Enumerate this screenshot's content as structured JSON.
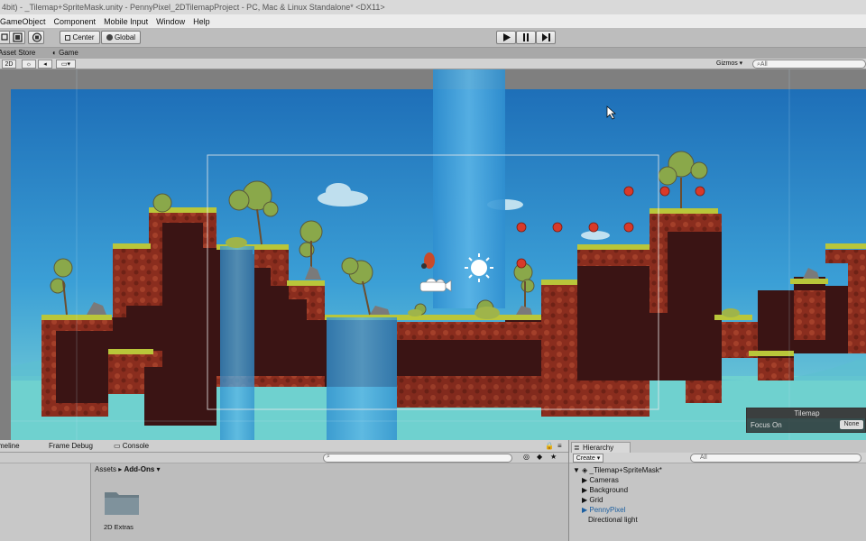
{
  "window": {
    "title": "4bit) - _Tilemap+SpriteMask.unity - PennyPixel_2DTilemapProject - PC, Mac & Linux Standalone* <DX11>"
  },
  "menu": {
    "items": [
      "GameObject",
      "Component",
      "Mobile Input",
      "Window",
      "Help"
    ]
  },
  "toolbar": {
    "pivot_label": "Center",
    "space_label": "Global",
    "play_icon": "play-icon",
    "pause_icon": "pause-icon",
    "step_icon": "step-icon"
  },
  "tabs": {
    "asset_store": "Asset Store",
    "game": "Game"
  },
  "scene_toolbar": {
    "mode_2d": "2D",
    "gizmos": "Gizmos",
    "search_prefix": "All"
  },
  "tilemap_panel": {
    "title": "Tilemap",
    "focus_label": "Focus On",
    "focus_value": "None"
  },
  "bottom_tabs": {
    "timeline": "meline",
    "frame_debug": "Frame Debug",
    "console": "Console"
  },
  "project": {
    "path_root": "Assets",
    "path_sep": "▸",
    "path_current": "Add-Ons",
    "folder_label": "2D Extras"
  },
  "hierarchy": {
    "tab": "Hierarchy",
    "create": "Create",
    "search_prefix": "All",
    "scene": "_Tilemap+SpriteMask*",
    "items": [
      {
        "label": "Cameras",
        "expandable": true,
        "prefab": false
      },
      {
        "label": "Background",
        "expandable": true,
        "prefab": false
      },
      {
        "label": "Grid",
        "expandable": true,
        "prefab": false
      },
      {
        "label": "PennyPixel",
        "expandable": true,
        "prefab": true
      },
      {
        "label": "Directional light",
        "expandable": false,
        "prefab": false
      }
    ]
  },
  "colors": {
    "sky_top": "#1e6fb8",
    "sky_bottom": "#79d0d8",
    "dirt": "#8a2d1e",
    "dirt_dark": "#3a1414",
    "grass": "#b9c63a",
    "water": "#3aa0d8",
    "prefab_text": "#1c5fa0"
  }
}
